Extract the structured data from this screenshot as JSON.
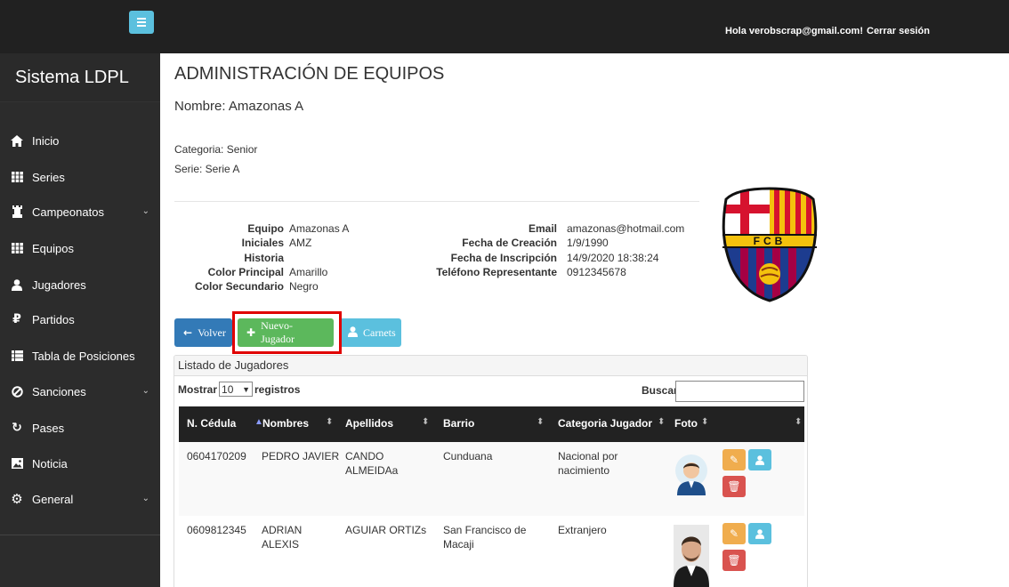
{
  "topbar": {
    "greeting": "Hola verobscrap@gmail.com!",
    "logout": "Cerrar sesión"
  },
  "sidebar": {
    "brand": "Sistema LDPL",
    "items": [
      {
        "label": "Inicio",
        "icon": "home-icon"
      },
      {
        "label": "Series",
        "icon": "grid-icon"
      },
      {
        "label": "Campeonatos",
        "icon": "tower-icon",
        "has_submenu": true
      },
      {
        "label": "Equipos",
        "icon": "grid-icon"
      },
      {
        "label": "Jugadores",
        "icon": "user-icon"
      },
      {
        "label": "Partidos",
        "icon": "ruble-icon"
      },
      {
        "label": "Tabla de Posiciones",
        "icon": "list-icon"
      },
      {
        "label": "Sanciones",
        "icon": "ban-icon",
        "has_submenu": true
      },
      {
        "label": "Pases",
        "icon": "transfer-icon"
      },
      {
        "label": "Noticia",
        "icon": "picture-icon"
      },
      {
        "label": "General",
        "icon": "gear-icon",
        "has_submenu": true
      }
    ]
  },
  "main": {
    "title": "ADMINISTRACIÓN DE EQUIPOS",
    "team_name": "Nombre: Amazonas A",
    "category": "Categoria: Senior",
    "serie": "Serie: Serie A",
    "info_left": [
      {
        "label": "Equipo",
        "value": "Amazonas A"
      },
      {
        "label": "Iniciales",
        "value": "AMZ"
      },
      {
        "label": "Historia",
        "value": ""
      },
      {
        "label": "Color Principal",
        "value": "Amarillo"
      },
      {
        "label": "Color Secundario",
        "value": "Negro"
      }
    ],
    "info_right": [
      {
        "label": "Email",
        "value": "amazonas@hotmail.com"
      },
      {
        "label": "Fecha de Creación",
        "value": "1/9/1990"
      },
      {
        "label": "Fecha de Inscripción",
        "value": "14/9/2020 18:38:24"
      },
      {
        "label": "Teléfono Representante",
        "value": "0912345678"
      }
    ],
    "crest_text": "FCB",
    "buttons": {
      "back": "Volver",
      "new_player": "Nuevo-Jugador",
      "cards": "Carnets"
    }
  },
  "players_panel": {
    "heading": "Listado de Jugadores",
    "show_prefix": "Mostrar",
    "page_size": "10",
    "show_suffix": "registros",
    "search_label": "Buscar:",
    "search_value": "",
    "columns": [
      "N. Cédula",
      "Nombres",
      "Apellidos",
      "Barrio",
      "Categoria Jugador",
      "Foto"
    ],
    "rows": [
      {
        "cedula": "0604170209",
        "nombres": "PEDRO JAVIER",
        "apellidos": "CANDO ALMEIDAa",
        "barrio": "Cunduana",
        "categoria": "Nacional por nacimiento"
      },
      {
        "cedula": "0609812345",
        "nombres": "ADRIAN ALEXIS",
        "apellidos": "AGUIAR ORTIZs",
        "barrio": "San Francisco de Macaji",
        "categoria": "Extranjero"
      }
    ]
  },
  "colors": {
    "topbar": "#212121",
    "sidebar": "#2c2c2c",
    "primary": "#337ab7",
    "success": "#5cb85c",
    "info": "#5bc0de",
    "warning": "#f0ad4e",
    "danger": "#d9534f",
    "highlight": "#e00000"
  }
}
